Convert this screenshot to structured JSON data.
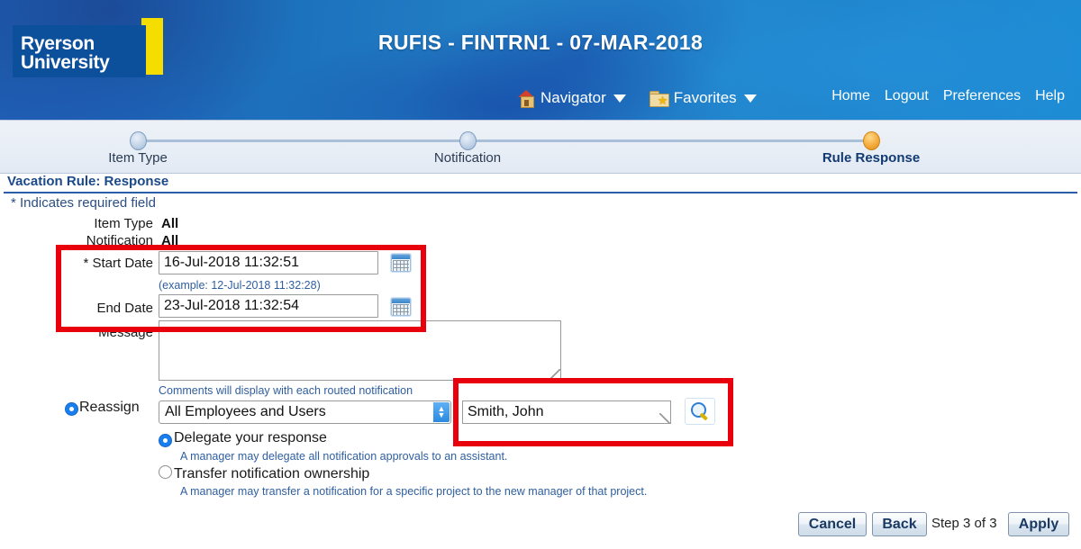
{
  "header": {
    "logo_text": "Ryerson\nUniversity",
    "app_title": "RUFIS - FINTRN1 - 07-MAR-2018",
    "nav": {
      "navigator_label": "Navigator",
      "favorites_label": "Favorites",
      "links": [
        "Home",
        "Logout",
        "Preferences",
        "Help"
      ]
    }
  },
  "train": {
    "steps": [
      {
        "label": "Item Type",
        "state": "visited"
      },
      {
        "label": "Notification",
        "state": "visited"
      },
      {
        "label": "Rule Response",
        "state": "active"
      }
    ]
  },
  "page": {
    "section_title": "Vacation Rule: Response",
    "required_note": "Indicates required field",
    "required_marker": "*"
  },
  "form": {
    "item_type": {
      "label": "Item Type",
      "value": "All"
    },
    "notification": {
      "label": "Notification",
      "value": "All"
    },
    "start_date": {
      "label": "Start Date",
      "required_marker": "*",
      "value": "16-Jul-2018 11:32:51",
      "hint": "(example: 12-Jul-2018 11:32:28)",
      "calendar_icon": "calendar-icon"
    },
    "end_date": {
      "label": "End Date",
      "value": "23-Jul-2018 11:32:54",
      "calendar_icon": "calendar-icon"
    },
    "message": {
      "label": "Message",
      "value": "",
      "hint": "Comments will display with each routed notification"
    },
    "reassign": {
      "label": "Reassign",
      "selected": true,
      "type_select": {
        "value": "All Employees and Users",
        "options": [
          "All Employees and Users"
        ]
      },
      "assignee": {
        "value": "Smith, John",
        "search_icon": "search-torch-icon"
      },
      "options": [
        {
          "label": "Delegate your response",
          "help": "A manager may delegate all notification approvals to an assistant.",
          "selected": true
        },
        {
          "label": "Transfer notification ownership",
          "help": "A manager may transfer a notification for a specific project to the new manager of that project.",
          "selected": false
        }
      ]
    }
  },
  "footer": {
    "cancel_label": "Cancel",
    "cancel_accesskey": "l",
    "back_label": "Back",
    "back_accesskey": "k",
    "step_text": "Step 3 of 3",
    "apply_label": "Apply",
    "apply_accesskey": "p"
  },
  "annotations": {
    "accent_red": "#e8000d",
    "boxes": [
      {
        "name": "date-fields-highlight"
      },
      {
        "name": "assignee-field-highlight"
      }
    ]
  }
}
